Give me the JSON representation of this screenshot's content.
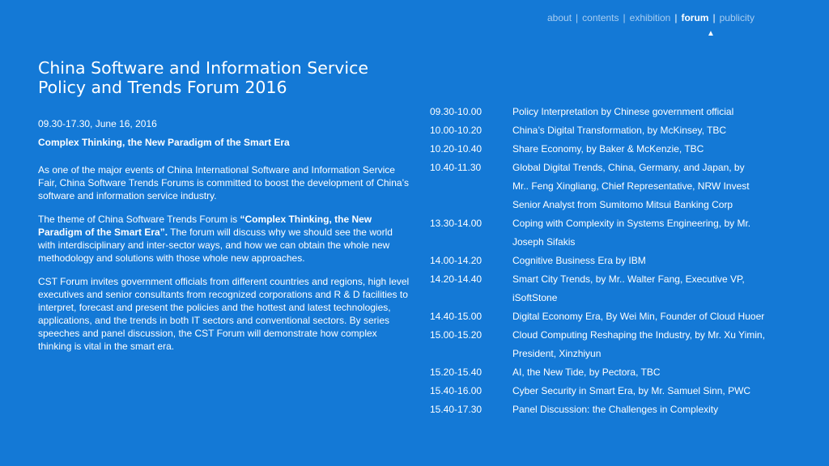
{
  "nav": {
    "items": [
      {
        "label": "about",
        "active": false
      },
      {
        "label": "contents",
        "active": false
      },
      {
        "label": "exhibition",
        "active": false
      },
      {
        "label": "forum",
        "active": true
      },
      {
        "label": "publicity",
        "active": false
      }
    ],
    "separator": "|",
    "caret": "▲"
  },
  "title": "China Software and Information Service Policy and Trends Forum 2016",
  "date": "09.30-17.30, June 16, 2016",
  "theme": "Complex Thinking, the New Paradigm of the Smart Era",
  "paragraph1": "As one of the major events of China International Software and Information Service Fair, China Software Trends Forums is committed to boost the development of China’s software and information service industry.",
  "paragraph2": {
    "before": "The theme of China Software Trends Forum is ",
    "bold": "“Complex Thinking, the New Paradigm of the Smart Era”.",
    "after": "  The forum will discuss why we should see the world with interdisciplinary and inter-sector ways, and how we can obtain the whole new methodology and solutions with those whole new approaches."
  },
  "paragraph3": "CST Forum invites government officials from different countries and regions, high level executives and senior consultants from recognized corporations and R & D facilities to interpret, forecast and present the policies and the hottest and latest technologies, applications, and the trends in both IT sectors and conventional sectors.  By series speeches and panel discussion, the CST Forum will demonstrate how complex thinking is vital in the smart era.",
  "schedule": [
    {
      "time": "09.30-10.00",
      "lines": [
        "Policy Interpretation by Chinese government official"
      ]
    },
    {
      "time": "10.00-10.20",
      "lines": [
        "China’s Digital Transformation, by McKinsey, TBC"
      ]
    },
    {
      "time": "10.20-10.40",
      "lines": [
        "Share Economy, by Baker & McKenzie, TBC"
      ]
    },
    {
      "time": "10.40-11.30",
      "lines": [
        "Global Digital Trends, China, Germany, and Japan, by",
        "Mr.. Feng Xingliang, Chief Representative, NRW Invest",
        "Senior Analyst from Sumitomo Mitsui Banking Corp"
      ]
    },
    {
      "time": "13.30-14.00",
      "lines": [
        "Coping with Complexity in Systems Engineering, by Mr.",
        "Joseph Sifakis"
      ]
    },
    {
      "time": "14.00-14.20",
      "lines": [
        "Cognitive Business Era by IBM"
      ]
    },
    {
      "time": "14.20-14.40",
      "lines": [
        "Smart City Trends, by Mr.. Walter Fang, Executive VP,",
        "iSoftStone"
      ]
    },
    {
      "time": "14.40-15.00",
      "lines": [
        "Digital Economy Era, By Wei Min, Founder of Cloud Huoer"
      ]
    },
    {
      "time": "15.00-15.20",
      "lines": [
        "Cloud Computing Reshaping the Industry, by Mr. Xu Yimin,",
        "President, Xinzhiyun"
      ]
    },
    {
      "time": "15.20-15.40",
      "lines": [
        "AI, the New Tide, by Pectora, TBC"
      ]
    },
    {
      "time": "15.40-16.00",
      "lines": [
        "Cyber Security in Smart Era, by Mr. Samuel Sinn, PWC"
      ]
    },
    {
      "time": "15.40-17.30",
      "lines": [
        "Panel Discussion: the Challenges in Complexity"
      ]
    }
  ]
}
